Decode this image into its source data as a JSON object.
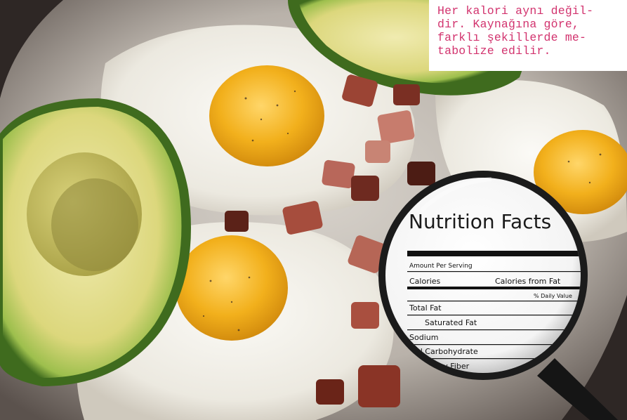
{
  "caption": {
    "lines": [
      "Her kalori aynı değil-",
      "dir. Kaynağına göre,",
      "farklı şekillerde me-",
      "tabolize edilir."
    ]
  },
  "nutrition_label": {
    "title": "Nutrition Facts",
    "amount_per_serving": "Amount Per Serving",
    "calories": "Calories",
    "calories_from_fat": "Calories from Fat",
    "daily_value": "% Daily Value",
    "total_fat": "Total Fat",
    "saturated_fat": "Saturated Fat",
    "sodium": "Sodium",
    "carbohydrate": "al Carbohydrate",
    "fiber": "ary Fiber"
  },
  "colors": {
    "caption_text": "#d2336e",
    "caption_bg": "#ffffff",
    "plate": "#e9e6e1",
    "egg_white": "#f3f1ea",
    "yolk": "#f2b01c",
    "avocado_flesh": "#e5e08e",
    "avocado_skin": "#3f6b1e",
    "bacon": "#8c3a2c"
  }
}
